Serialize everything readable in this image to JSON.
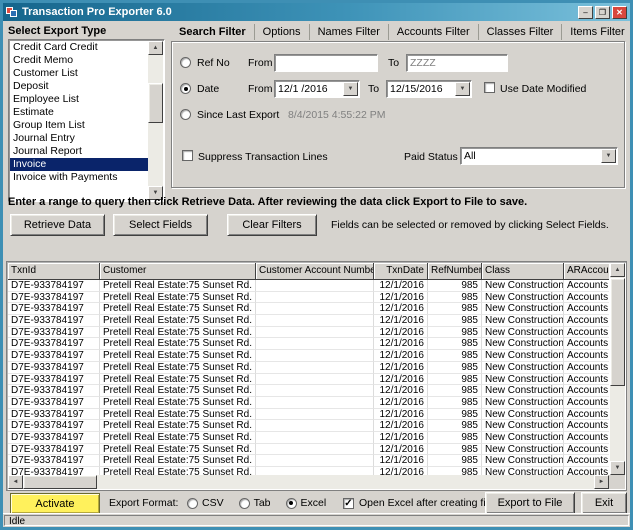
{
  "window": {
    "title": "Transaction Pro Exporter 6.0"
  },
  "icons": {
    "minimize": "–",
    "maximize": "❐",
    "close": "✕",
    "dropdown": "▼",
    "up": "▲",
    "down": "▼",
    "left": "◄",
    "right": "►",
    "check": "✓"
  },
  "export_type": {
    "label": "Select Export Type",
    "items": [
      "Credit Card Credit",
      "Credit Memo",
      "Customer List",
      "Deposit",
      "Employee List",
      "Estimate",
      "Group Item List",
      "Journal Entry",
      "Journal Report",
      "Invoice",
      "Invoice with Payments"
    ],
    "selected": "Invoice"
  },
  "tabs": {
    "items": [
      "Search Filter",
      "Options",
      "Names Filter",
      "Accounts Filter",
      "Classes Filter",
      "Items Filter"
    ],
    "active": "Search Filter"
  },
  "filters": {
    "ref_no": {
      "radio": "Ref No",
      "from_label": "From",
      "from_value": "",
      "to_label": "To",
      "to_value": "ZZZZ",
      "selected": false
    },
    "date": {
      "radio": "Date",
      "from_label": "From",
      "from_value": "12/1 /2016",
      "to_label": "To",
      "to_value": "12/15/2016",
      "selected": true
    },
    "use_date_modified": {
      "label": "Use Date Modified",
      "checked": false
    },
    "since_last_export": {
      "radio": "Since Last Export",
      "value": "8/4/2015 4:55:22 PM",
      "selected": false
    },
    "suppress_transaction_lines": {
      "label": "Suppress Transaction Lines",
      "checked": false
    },
    "paid_status": {
      "label": "Paid Status",
      "value": "All"
    }
  },
  "instruction": "Enter a range to query then click Retrieve Data. After reviewing the data click Export to File to save.",
  "actions": {
    "retrieve_data": "Retrieve Data",
    "select_fields": "Select Fields",
    "clear_filters": "Clear Filters",
    "hint": "Fields can be selected or removed by clicking Select Fields."
  },
  "grid": {
    "columns": [
      {
        "label": "TxnId",
        "width": 92,
        "align": "left"
      },
      {
        "label": "Customer",
        "width": 156,
        "align": "left"
      },
      {
        "label": "Customer Account Number",
        "width": 118,
        "align": "left"
      },
      {
        "label": "TxnDate",
        "width": 54,
        "align": "right"
      },
      {
        "label": "RefNumber",
        "width": 54,
        "align": "right"
      },
      {
        "label": "Class",
        "width": 82,
        "align": "left"
      },
      {
        "label": "ARAccount",
        "width": 80,
        "align": "left"
      }
    ],
    "rows": [
      [
        "D7E-933784197",
        "Pretell Real Estate:75 Sunset Rd.",
        "",
        "12/1/2016",
        "985",
        "New Construction",
        "Accounts R"
      ],
      [
        "D7E-933784197",
        "Pretell Real Estate:75 Sunset Rd.",
        "",
        "12/1/2016",
        "985",
        "New Construction",
        "Accounts R"
      ],
      [
        "D7E-933784197",
        "Pretell Real Estate:75 Sunset Rd.",
        "",
        "12/1/2016",
        "985",
        "New Construction",
        "Accounts R"
      ],
      [
        "D7E-933784197",
        "Pretell Real Estate:75 Sunset Rd.",
        "",
        "12/1/2016",
        "985",
        "New Construction",
        "Accounts R"
      ],
      [
        "D7E-933784197",
        "Pretell Real Estate:75 Sunset Rd.",
        "",
        "12/1/2016",
        "985",
        "New Construction",
        "Accounts R"
      ],
      [
        "D7E-933784197",
        "Pretell Real Estate:75 Sunset Rd.",
        "",
        "12/1/2016",
        "985",
        "New Construction",
        "Accounts R"
      ],
      [
        "D7E-933784197",
        "Pretell Real Estate:75 Sunset Rd.",
        "",
        "12/1/2016",
        "985",
        "New Construction",
        "Accounts R"
      ],
      [
        "D7E-933784197",
        "Pretell Real Estate:75 Sunset Rd.",
        "",
        "12/1/2016",
        "985",
        "New Construction",
        "Accounts R"
      ],
      [
        "D7E-933784197",
        "Pretell Real Estate:75 Sunset Rd.",
        "",
        "12/1/2016",
        "985",
        "New Construction",
        "Accounts R"
      ],
      [
        "D7E-933784197",
        "Pretell Real Estate:75 Sunset Rd.",
        "",
        "12/1/2016",
        "985",
        "New Construction",
        "Accounts R"
      ],
      [
        "D7E-933784197",
        "Pretell Real Estate:75 Sunset Rd.",
        "",
        "12/1/2016",
        "985",
        "New Construction",
        "Accounts R"
      ],
      [
        "D7E-933784197",
        "Pretell Real Estate:75 Sunset Rd.",
        "",
        "12/1/2016",
        "985",
        "New Construction",
        "Accounts R"
      ],
      [
        "D7E-933784197",
        "Pretell Real Estate:75 Sunset Rd.",
        "",
        "12/1/2016",
        "985",
        "New Construction",
        "Accounts R"
      ],
      [
        "D7E-933784197",
        "Pretell Real Estate:75 Sunset Rd.",
        "",
        "12/1/2016",
        "985",
        "New Construction",
        "Accounts R"
      ],
      [
        "D7E-933784197",
        "Pretell Real Estate:75 Sunset Rd.",
        "",
        "12/1/2016",
        "985",
        "New Construction",
        "Accounts R"
      ],
      [
        "D7E-933784197",
        "Pretell Real Estate:75 Sunset Rd.",
        "",
        "12/1/2016",
        "985",
        "New Construction",
        "Accounts R"
      ],
      [
        "D7E-933784197",
        "Pretell Real Estate:75 Sunset Rd.",
        "",
        "12/1/2016",
        "985",
        "New Construction",
        "Accounts R"
      ]
    ]
  },
  "footer": {
    "activate": "Activate",
    "export_format_label": "Export Format:",
    "formats": [
      "CSV",
      "Tab",
      "Excel"
    ],
    "selected_format": "Excel",
    "open_excel_label": "Open Excel after creating file",
    "open_excel_checked": true,
    "export_to_file": "Export to File",
    "exit": "Exit"
  },
  "status": {
    "text": "Idle"
  },
  "colors": {
    "titlebar": "#3E93B8",
    "selection": "#0A246A",
    "activate": "#FFF15C"
  }
}
